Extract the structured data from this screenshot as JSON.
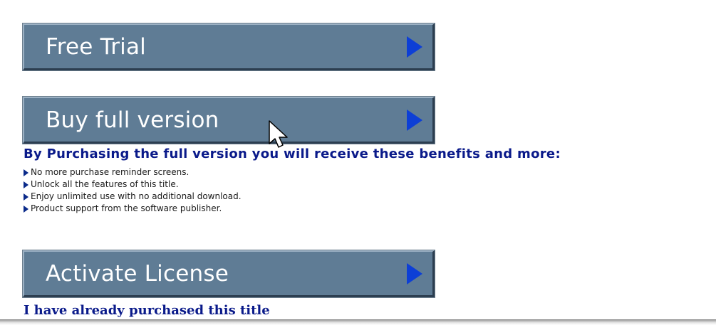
{
  "buttons": {
    "free_trial": "Free Trial",
    "buy_full": "Buy full version",
    "activate": "Activate License"
  },
  "benefits": {
    "heading": "By Purchasing the full version you will receive these benefits and more:",
    "items": [
      "No more purchase reminder screens.",
      "Unlock all the features of this title.",
      "Enjoy unlimited use with no additional download.",
      "Product support from the software publisher."
    ]
  },
  "activate_note": "I have already purchased this title",
  "colors": {
    "button_bg": "#5f7c95",
    "arrow": "#0d3fd6",
    "heading_text": "#0a1a8a"
  },
  "icons": {
    "button_arrow": "play-arrow-icon",
    "bullet": "bullet-arrow-icon",
    "cursor": "mouse-pointer-icon"
  }
}
